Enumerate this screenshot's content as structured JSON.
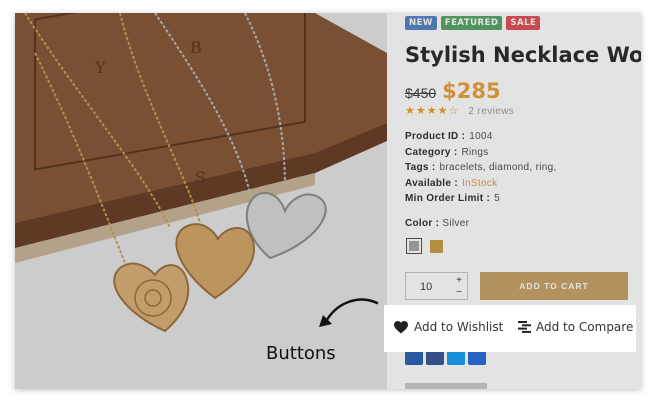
{
  "badges": {
    "new": "NEW",
    "featured": "FEATURED",
    "sale": "SALE"
  },
  "product": {
    "title": "Stylish Necklace Wor",
    "old_price": "$450",
    "price": "$285",
    "rating_stars": 4.5,
    "reviews": "2 reviews"
  },
  "meta": {
    "id_label": "Product ID :",
    "id_value": "1004",
    "category_label": "Category :",
    "category_value": "Rings",
    "tags_label": "Tags :",
    "tags_value": "bracelets, diamond, ring,",
    "available_label": "Available :",
    "available_value": "InStock",
    "min_order_label": "Min Order Limit :",
    "min_order_value": "5"
  },
  "color": {
    "label": "Color :",
    "value": "Silver",
    "swatches": [
      "#a8a8a8",
      "#c9a24a"
    ]
  },
  "quantity": {
    "value": "10",
    "up": "+",
    "down": "−"
  },
  "add_to_cart": "ADD TO CART",
  "actions": {
    "wishlist": "Add to Wishlist",
    "compare": "Add to Compare"
  },
  "callout": "Buttons",
  "icons": [
    "heart-icon",
    "compare-icon",
    "arrow-icon",
    "star-icon"
  ]
}
